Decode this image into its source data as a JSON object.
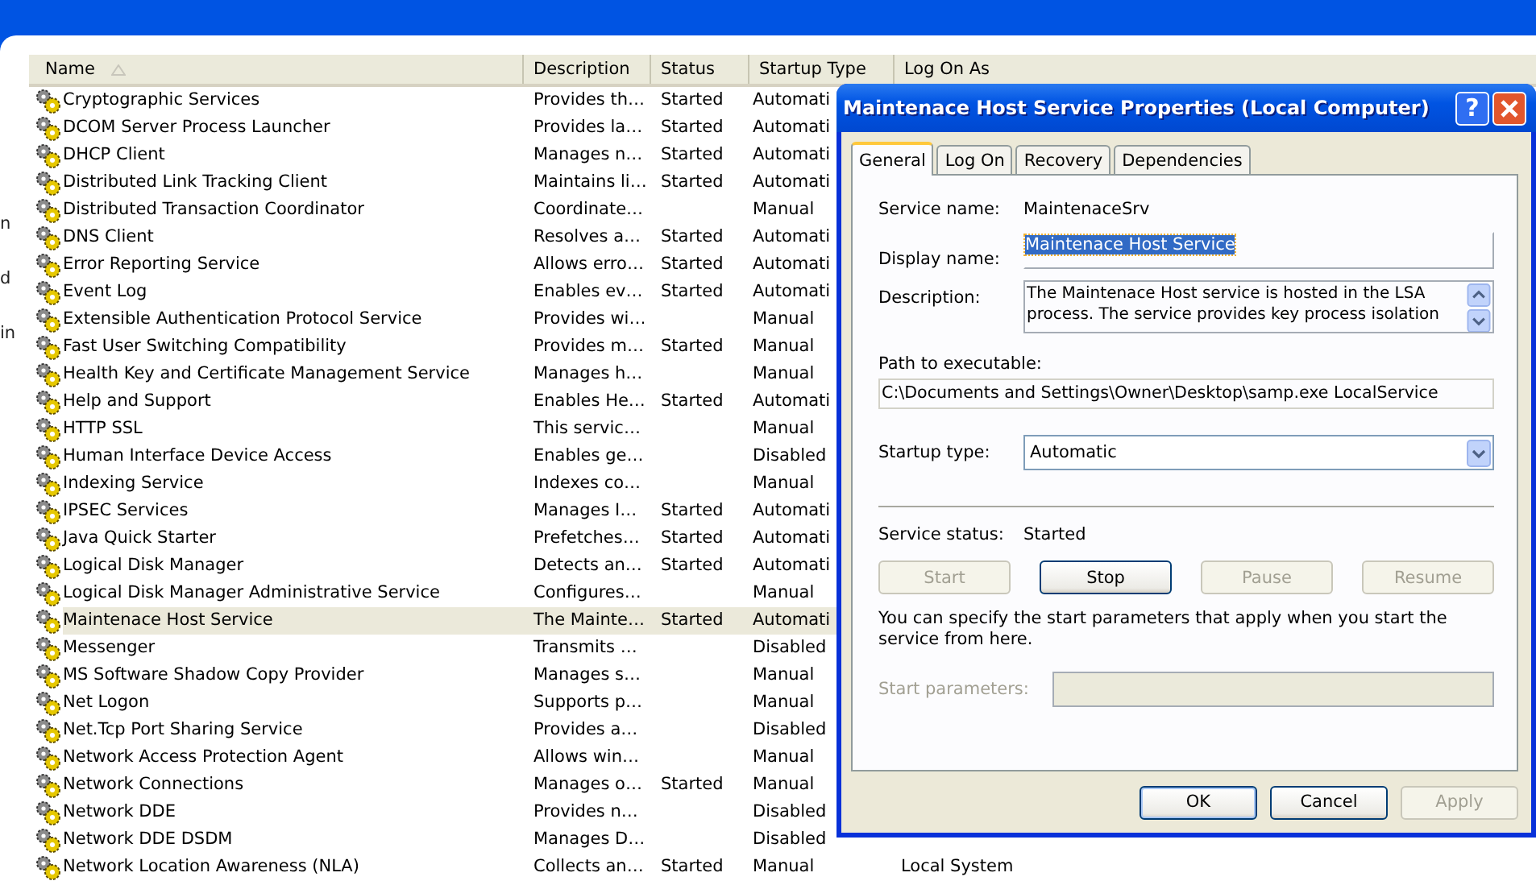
{
  "left_pane": {
    "fragments": [
      "n",
      "d",
      "in"
    ]
  },
  "table": {
    "columns": [
      {
        "label": "Name",
        "sorted": true
      },
      {
        "label": "Description",
        "sorted": false
      },
      {
        "label": "Status",
        "sorted": false
      },
      {
        "label": "Startup Type",
        "sorted": false
      },
      {
        "label": "Log On As",
        "sorted": false
      }
    ],
    "rows": [
      {
        "name": "Cryptographic Services",
        "description": "Provides th…",
        "status": "Started",
        "startup_type": "Automati",
        "selected": false
      },
      {
        "name": "DCOM Server Process Launcher",
        "description": "Provides la…",
        "status": "Started",
        "startup_type": "Automati",
        "selected": false
      },
      {
        "name": "DHCP Client",
        "description": "Manages n…",
        "status": "Started",
        "startup_type": "Automati",
        "selected": false
      },
      {
        "name": "Distributed Link Tracking Client",
        "description": "Maintains li…",
        "status": "Started",
        "startup_type": "Automati",
        "selected": false
      },
      {
        "name": "Distributed Transaction Coordinator",
        "description": "Coordinate…",
        "startup_type": "Manual",
        "selected": false
      },
      {
        "name": "DNS Client",
        "description": "Resolves a…",
        "status": "Started",
        "startup_type": "Automati",
        "selected": false
      },
      {
        "name": "Error Reporting Service",
        "description": "Allows erro…",
        "status": "Started",
        "startup_type": "Automati",
        "selected": false
      },
      {
        "name": "Event Log",
        "description": "Enables ev…",
        "status": "Started",
        "startup_type": "Automati",
        "selected": false
      },
      {
        "name": "Extensible Authentication Protocol Service",
        "description": "Provides wi…",
        "startup_type": "Manual",
        "selected": false
      },
      {
        "name": "Fast User Switching Compatibility",
        "description": "Provides m…",
        "status": "Started",
        "startup_type": "Manual",
        "selected": false
      },
      {
        "name": "Health Key and Certificate Management Service",
        "description": "Manages h…",
        "startup_type": "Manual",
        "selected": false
      },
      {
        "name": "Help and Support",
        "description": "Enables He…",
        "status": "Started",
        "startup_type": "Automati",
        "selected": false
      },
      {
        "name": "HTTP SSL",
        "description": "This servic…",
        "startup_type": "Manual",
        "selected": false
      },
      {
        "name": "Human Interface Device Access",
        "description": "Enables ge…",
        "startup_type": "Disabled",
        "selected": false
      },
      {
        "name": "Indexing Service",
        "description": "Indexes co…",
        "startup_type": "Manual",
        "selected": false
      },
      {
        "name": "IPSEC Services",
        "description": "Manages I…",
        "status": "Started",
        "startup_type": "Automati",
        "selected": false
      },
      {
        "name": "Java Quick Starter",
        "description": "Prefetches…",
        "status": "Started",
        "startup_type": "Automati",
        "selected": false
      },
      {
        "name": "Logical Disk Manager",
        "description": "Detects an…",
        "status": "Started",
        "startup_type": "Automati",
        "selected": false
      },
      {
        "name": "Logical Disk Manager Administrative Service",
        "description": "Configures…",
        "startup_type": "Manual",
        "selected": false
      },
      {
        "name": "Maintenace Host Service",
        "description": "The Mainte…",
        "status": "Started",
        "startup_type": "Automati",
        "selected": true
      },
      {
        "name": "Messenger",
        "description": "Transmits …",
        "startup_type": "Disabled",
        "selected": false
      },
      {
        "name": "MS Software Shadow Copy Provider",
        "description": "Manages s…",
        "startup_type": "Manual",
        "selected": false
      },
      {
        "name": "Net Logon",
        "description": "Supports p…",
        "startup_type": "Manual",
        "selected": false
      },
      {
        "name": "Net.Tcp Port Sharing Service",
        "description": "Provides a…",
        "startup_type": "Disabled",
        "selected": false
      },
      {
        "name": "Network Access Protection Agent",
        "description": "Allows win…",
        "startup_type": "Manual",
        "selected": false
      },
      {
        "name": "Network Connections",
        "description": "Manages o…",
        "status": "Started",
        "startup_type": "Manual",
        "selected": false
      },
      {
        "name": "Network DDE",
        "description": "Provides n…",
        "startup_type": "Disabled",
        "selected": false
      },
      {
        "name": "Network DDE DSDM",
        "description": "Manages D…",
        "startup_type": "Disabled",
        "selected": false
      },
      {
        "name": "Network Location Awareness (NLA)",
        "description": "Collects an…",
        "status": "Started",
        "startup_type": "Manual",
        "log_on_as": "Local System",
        "selected": false
      }
    ]
  },
  "dialog": {
    "title": "Maintenace Host Service Properties (Local Computer)",
    "help_button": "?",
    "tabs": [
      {
        "label": "General",
        "selected": true
      },
      {
        "label": "Log On",
        "selected": false
      },
      {
        "label": "Recovery",
        "selected": false
      },
      {
        "label": "Dependencies",
        "selected": false
      }
    ],
    "service_name_label": "Service name:",
    "service_name": "MaintenaceSrv",
    "display_name_label": "Display name:",
    "display_name": "Maintenace Host Service",
    "description_label": "Description:",
    "description": "The Maintenace Host service is hosted in the LSA process. The service provides key process isolation",
    "path_label": "Path to executable:",
    "path": "C:\\Documents and Settings\\Owner\\Desktop\\samp.exe LocalService",
    "startup_type_label": "Startup type:",
    "startup_type": "Automatic",
    "service_status_label": "Service status:",
    "service_status": "Started",
    "control_buttons": [
      {
        "label": "Start",
        "disabled": true
      },
      {
        "label": "Stop",
        "disabled": false
      },
      {
        "label": "Pause",
        "disabled": true
      },
      {
        "label": "Resume",
        "disabled": true
      }
    ],
    "hint": "You can specify the start parameters that apply when you start the service from here.",
    "start_parameters_label": "Start parameters:",
    "start_parameters_disabled": true,
    "footer_buttons": [
      {
        "label": "OK",
        "disabled": false,
        "default": true
      },
      {
        "label": "Cancel",
        "disabled": false,
        "default": false
      },
      {
        "label": "Apply",
        "disabled": true,
        "default": false
      }
    ]
  }
}
